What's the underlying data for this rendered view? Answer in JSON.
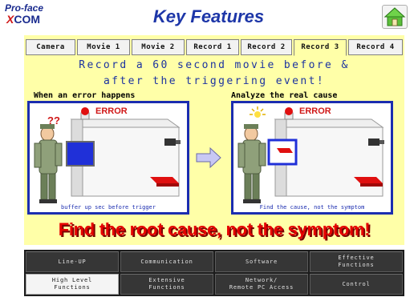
{
  "header": {
    "logo_line1": "Pro-face",
    "logo_line2_x": "X",
    "logo_line2_rest": "COM",
    "title": "Key Features",
    "home_icon": "home-icon"
  },
  "tabs": [
    {
      "label": "Camera",
      "active": false
    },
    {
      "label": "Movie 1",
      "active": false
    },
    {
      "label": "Movie 2",
      "active": false
    },
    {
      "label": "Record 1",
      "active": false
    },
    {
      "label": "Record 2",
      "active": false
    },
    {
      "label": "Record 3",
      "active": true
    },
    {
      "label": "Record 4",
      "active": false
    }
  ],
  "content": {
    "headline_line1": "Record a 60 second movie before &",
    "headline_line2": "after the triggering event!",
    "left_caption": "When an error happens",
    "right_caption": "Analyze the real cause",
    "left_error": "ERROR",
    "right_error": "ERROR",
    "question_marks": "??",
    "left_subtitle": "buffer up sec before trigger",
    "right_subtitle": "Find the cause, not the symptom",
    "banner": "Find the root cause, not the symptom!"
  },
  "nav": {
    "row1": [
      "Line-UP",
      "Communication",
      "Software",
      "Effective\nFunctions"
    ],
    "row2": [
      "High Level\nFunctions",
      "Extensive\nFunctions",
      "Network/\nRemote PC Access",
      "Control"
    ],
    "active": "High Level\nFunctions"
  },
  "colors": {
    "title": "#1d36a8",
    "panel": "#ffffa8",
    "frame": "#1b2db0",
    "banner": "#e60000",
    "nav_bg": "#1c1c1c"
  }
}
